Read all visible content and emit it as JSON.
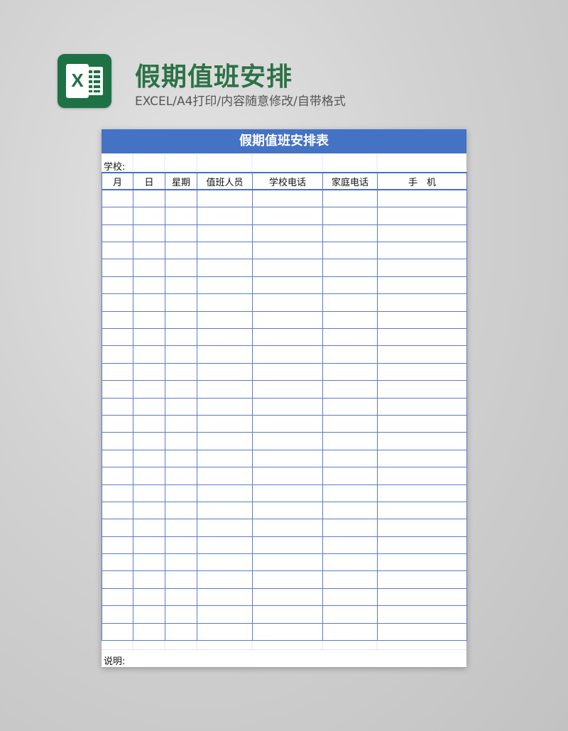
{
  "header": {
    "title": "假期值班安排",
    "subtitle": "EXCEL/A4打印/内容随意修改/自带格式",
    "icon": "excel-icon",
    "icon_letter": "X"
  },
  "sheet": {
    "title": "假期值班安排表",
    "school_label": "学校:",
    "columns": [
      "月",
      "日",
      "星期",
      "值班人员",
      "学校电话",
      "家庭电话",
      "手　机"
    ],
    "note_label": "说明:"
  },
  "colors": {
    "accent": "#4472c4",
    "brand": "#1e7145",
    "title_green": "#2c7247"
  }
}
